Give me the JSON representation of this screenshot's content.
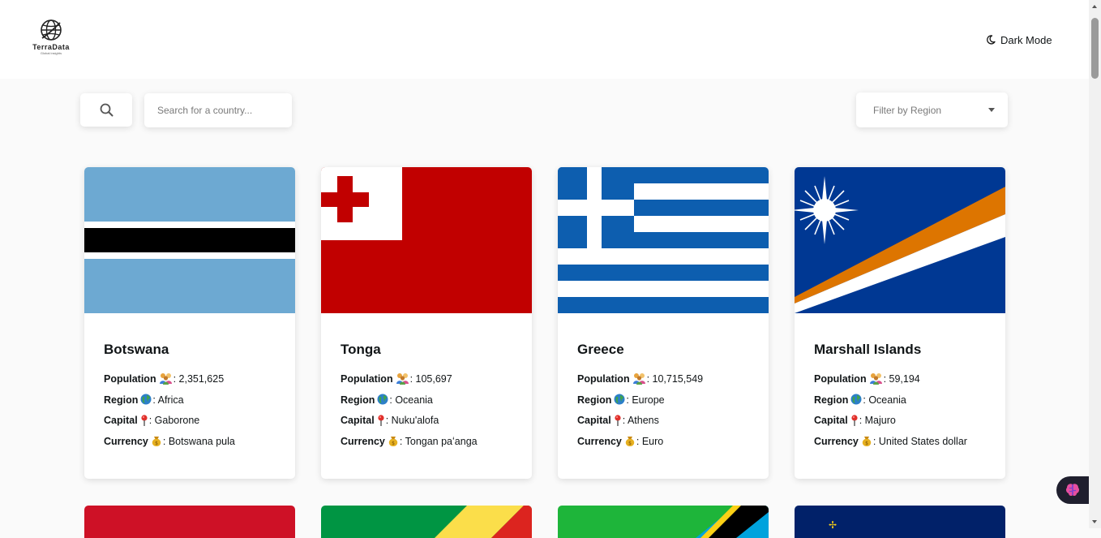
{
  "header": {
    "logo_name": "TerraData",
    "logo_tagline": "Global insights",
    "dark_mode_label": "Dark Mode"
  },
  "toolbar": {
    "search_placeholder": "Search for a country...",
    "region_filter_label": "Filter by Region"
  },
  "labels": {
    "population": "Population",
    "region": "Region",
    "capital": "Capital",
    "currency": "Currency"
  },
  "countries": [
    {
      "name": "Botswana",
      "population": "2,351,625",
      "region": "Africa",
      "capital": "Gaborone",
      "currency": "Botswana pula"
    },
    {
      "name": "Tonga",
      "population": "105,697",
      "region": "Oceania",
      "capital": "Nuku'alofa",
      "currency": "Tongan paʻanga"
    },
    {
      "name": "Greece",
      "population": "10,715,549",
      "region": "Europe",
      "capital": "Athens",
      "currency": "Euro"
    },
    {
      "name": "Marshall Islands",
      "population": "59,194",
      "region": "Oceania",
      "capital": "Majuro",
      "currency": "United States dollar"
    }
  ],
  "icons": {
    "search": "search-icon",
    "moon": "moon-icon",
    "population": "people-icon",
    "region": "globe-icon",
    "capital": "pin-icon",
    "currency": "money-bag-icon",
    "filter": "caret-down-icon",
    "widget": "brain-icon"
  },
  "colors": {
    "background": "#fafafa",
    "card": "#ffffff",
    "text": "#111517",
    "placeholder": "#7a7a7a"
  }
}
